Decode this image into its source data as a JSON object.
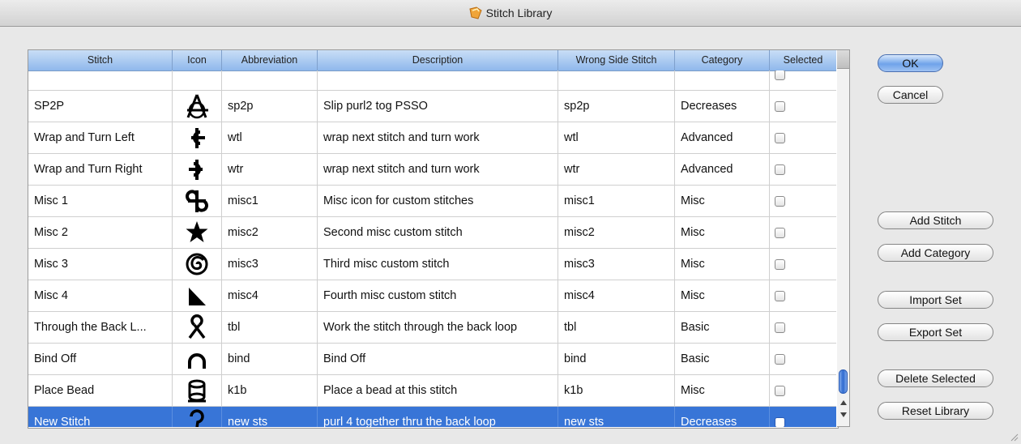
{
  "window": {
    "title": "Stitch Library"
  },
  "table": {
    "columns": [
      "Stitch",
      "Icon",
      "Abbreviation",
      "Description",
      "Wrong Side Stitch",
      "Category",
      "Selected"
    ],
    "rows": [
      {
        "stitch": "",
        "icon": "partial-icon",
        "abbreviation": "",
        "description": "",
        "wrong_side": "",
        "category": "",
        "selected": false
      },
      {
        "stitch": "SP2P",
        "icon": "sp2p-icon",
        "abbreviation": "sp2p",
        "description": "Slip purl2 tog PSSO",
        "wrong_side": "sp2p",
        "category": "Decreases",
        "selected": false
      },
      {
        "stitch": "Wrap and Turn Left",
        "icon": "wrap-turn-left-icon",
        "abbreviation": "wtl",
        "description": "wrap next stitch and turn work",
        "wrong_side": "wtl",
        "category": "Advanced",
        "selected": false
      },
      {
        "stitch": "Wrap and Turn Right",
        "icon": "wrap-turn-right-icon",
        "abbreviation": "wtr",
        "description": "wrap next stitch and turn work",
        "wrong_side": "wtr",
        "category": "Advanced",
        "selected": false
      },
      {
        "stitch": "Misc 1",
        "icon": "misc1-icon",
        "abbreviation": "misc1",
        "description": "Misc icon for custom stitches",
        "wrong_side": "misc1",
        "category": "Misc",
        "selected": false
      },
      {
        "stitch": "Misc 2",
        "icon": "star-icon",
        "abbreviation": "misc2",
        "description": "Second misc custom stitch",
        "wrong_side": "misc2",
        "category": "Misc",
        "selected": false
      },
      {
        "stitch": "Misc 3",
        "icon": "spiral-icon",
        "abbreviation": "misc3",
        "description": "Third misc custom stitch",
        "wrong_side": "misc3",
        "category": "Misc",
        "selected": false
      },
      {
        "stitch": "Misc 4",
        "icon": "triangle-icon",
        "abbreviation": "misc4",
        "description": "Fourth misc custom stitch",
        "wrong_side": "misc4",
        "category": "Misc",
        "selected": false
      },
      {
        "stitch": "Through the Back L...",
        "icon": "back-loop-icon",
        "abbreviation": "tbl",
        "description": "Work the stitch through the back loop",
        "wrong_side": "tbl",
        "category": "Basic",
        "selected": false
      },
      {
        "stitch": "Bind Off",
        "icon": "bind-off-icon",
        "abbreviation": "bind",
        "description": "Bind Off",
        "wrong_side": "bind",
        "category": "Basic",
        "selected": false
      },
      {
        "stitch": "Place Bead",
        "icon": "bead-icon",
        "abbreviation": "k1b",
        "description": "Place a bead at this stitch",
        "wrong_side": "k1b",
        "category": "Misc",
        "selected": false
      },
      {
        "stitch": "New Stitch",
        "icon": "question-icon",
        "abbreviation": "new sts",
        "description": "purl 4 together thru the back loop",
        "wrong_side": "new sts",
        "category": "Decreases",
        "selected": false,
        "highlighted": true
      }
    ]
  },
  "buttons": {
    "ok": "OK",
    "cancel": "Cancel",
    "add_stitch": "Add Stitch",
    "add_category": "Add Category",
    "import_set": "Import Set",
    "export_set": "Export Set",
    "delete_selected": "Delete Selected",
    "reset_library": "Reset Library"
  },
  "colors": {
    "selection": "#3875d7",
    "header": "#a9c8f0"
  }
}
